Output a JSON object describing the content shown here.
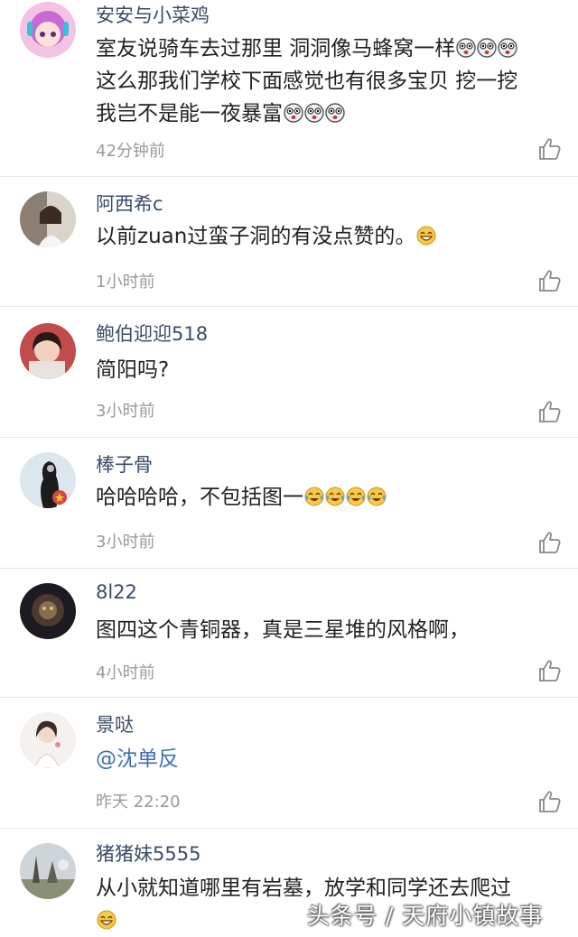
{
  "comments": [
    {
      "username": "安安与小菜鸡",
      "text": "室友说骑车去过那里 洞洞像马蜂窝一样",
      "text2": "这么那我们学校下面感觉也有很多宝贝 挖一挖",
      "text3": "我岂不是能一夜暴富",
      "time": "42分钟前",
      "emoji": "shocked-face"
    },
    {
      "username": "阿西希c",
      "text": "以前zuan过蛮子洞的有没点赞的。",
      "time": "1小时前",
      "emoji": "laughing-face"
    },
    {
      "username": "鲍伯迎迎518",
      "text": "简阳吗?",
      "time": "3小时前"
    },
    {
      "username": "棒子骨",
      "text": "哈哈哈哈，不包括图一",
      "time": "3小时前",
      "emoji": "tears-of-joy-face"
    },
    {
      "username": "8l22",
      "text": "图四这个青铜器，真是三星堆的风格啊，",
      "time": "4小时前"
    },
    {
      "username": "景哒",
      "mention": "@沈单反",
      "time": "昨天 22:20"
    },
    {
      "username": "猪猪妹5555",
      "text": "从小就知道哪里有岩墓，放学和同学还去爬过",
      "emoji": "laughing-face"
    }
  ],
  "watermark": "头条号 / 天府小镇故事",
  "colors": {
    "username": "#3b4c66",
    "text": "#222222",
    "time": "#9a9a9a",
    "mention": "#3f6fb5",
    "divider": "#e6e6e6"
  }
}
